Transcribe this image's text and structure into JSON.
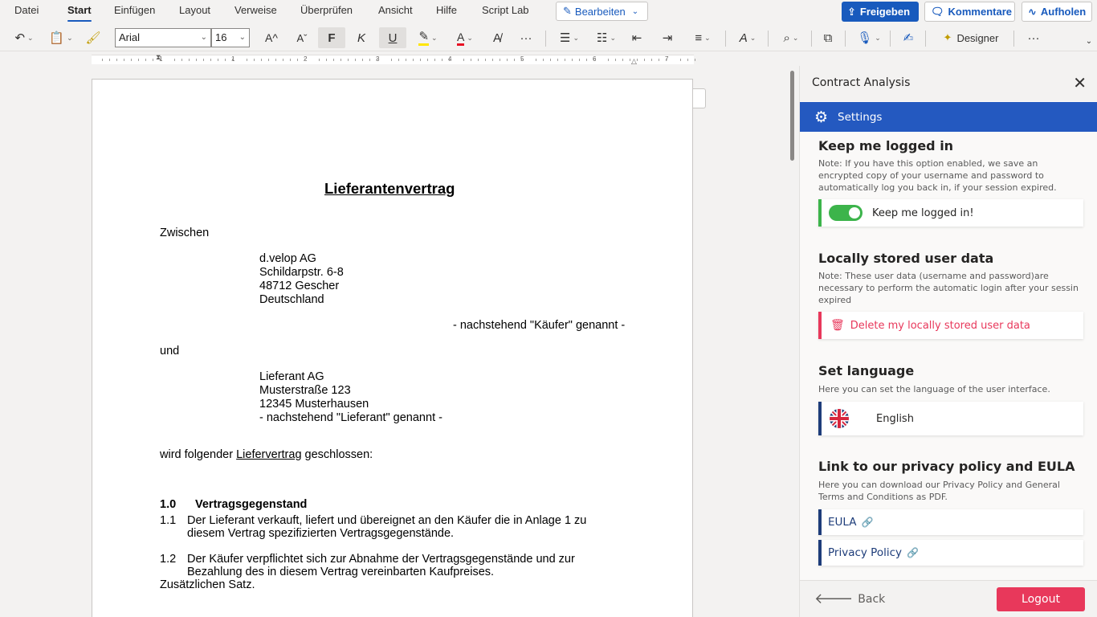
{
  "menu": {
    "tabs": [
      "Datei",
      "Start",
      "Einfügen",
      "Layout",
      "Verweise",
      "Überprüfen",
      "Ansicht",
      "Hilfe",
      "Script Lab"
    ],
    "active_tab": "Start",
    "edit_mode": "Bearbeiten",
    "share": "Freigeben",
    "comments": "Kommentare",
    "catch_up": "Aufholen"
  },
  "toolbar": {
    "font_name": "Arial",
    "font_size": "16",
    "bold": "F",
    "italic": "K",
    "underline": "U",
    "grow_font": "A^",
    "shrink_font": "Aˇ",
    "more": "···",
    "designer": "Designer",
    "overflow": "···"
  },
  "ruler": {
    "numbers": [
      "1",
      "1",
      "2",
      "3",
      "4",
      "5",
      "6",
      "7"
    ]
  },
  "document": {
    "title": "Lieferantenvertrag",
    "between": "Zwischen",
    "buyer": [
      "d.velop AG",
      "Schildarpstr. 6-8",
      "48712 Gescher",
      "Deutschland"
    ],
    "buyer_named": "- nachstehend \"Käufer\" genannt -",
    "and": "und",
    "supplier": [
      "Lieferant AG",
      "Musterstraße 123",
      "12345 Musterhausen",
      "- nachstehend \"Lieferant\" genannt -"
    ],
    "intro_before": "wird folgender ",
    "intro_link": "Liefervertrag",
    "intro_after": " geschlossen:",
    "section_num": "1.0",
    "section_title": "Vertragsgegenstand",
    "p1_num": "1.1",
    "p1_line1": "Der Lieferant verkauft, liefert und übereignet an den Käufer die in Anlage 1 zu",
    "p1_line2": "diesem Vertrag spezifizierten Vertragsgegenstände.",
    "p2_num": "1.2",
    "p2_line1": "Der Käufer verpflichtet sich zur Abnahme der Vertragsgegenstände und zur",
    "p2_line2": "Bezahlung des in diesem Vertrag vereinbarten Kaufpreises.",
    "p3": "Zusätzlichen Satz."
  },
  "pane": {
    "title": "Contract Analysis",
    "close": "✕",
    "settings_label": "Settings",
    "keep_logged": {
      "title": "Keep me logged in",
      "note": "Note: If you have this option enabled, we save an encrypted copy of your username and password to automatically log you back in, if your session expired.",
      "toggle_label": "Keep me logged in!",
      "toggle_on": true
    },
    "local_data": {
      "title": "Locally stored user data",
      "note": "Note: These user data (username and password)are necessary to perform the automatic login after your sessin expired",
      "delete_label": "Delete my locally stored user data"
    },
    "language": {
      "title": "Set language",
      "note": "Here you can set the language of the user interface.",
      "selected": "English"
    },
    "privacy": {
      "title": "Link to our privacy policy and EULA",
      "note": "Here you can download our Privacy Policy and General Terms and Conditions as PDF.",
      "eula": "EULA",
      "privacy_policy": "Privacy Policy"
    },
    "back": "Back",
    "logout": "Logout"
  },
  "colors": {
    "accent": "#185abd",
    "settings_bar": "#2459c0",
    "toggle_on": "#3cb44b",
    "danger": "#e8385b",
    "link_navy": "#1e3d7a"
  }
}
